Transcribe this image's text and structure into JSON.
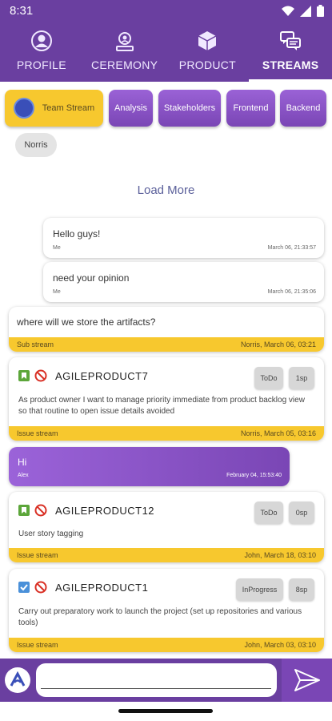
{
  "status_bar": {
    "time": "8:31"
  },
  "tabs": [
    {
      "label": "PROFILE",
      "icon": "person-icon",
      "active": false
    },
    {
      "label": "CEREMONY",
      "icon": "ceremony-icon",
      "active": false
    },
    {
      "label": "PRODUCT",
      "icon": "box-icon",
      "active": false
    },
    {
      "label": "STREAMS",
      "icon": "chat-icon",
      "active": true
    }
  ],
  "streams": {
    "team": "Team Stream",
    "items": [
      "Analysis",
      "Stakeholders",
      "Frontend",
      "Backend"
    ]
  },
  "members": [
    "Norris"
  ],
  "load_more": "Load More",
  "messages": [
    {
      "text": "Hello guys!",
      "sender": "Me",
      "time": "March 06, 21:33:57"
    },
    {
      "text": "need your opinion",
      "sender": "Me",
      "time": "March 06, 21:35:06"
    }
  ],
  "sub_stream_msg": {
    "text": "where will we store the artifacts?",
    "type": "Sub stream",
    "meta": "Norris,    March 06, 03:21"
  },
  "issues": [
    {
      "id": "AGILEPRODUCT7",
      "status": "ToDo",
      "points": "1sp",
      "description": "As product owner I want to manage priority immediate from product backlog view so that routine to open issue details avoided",
      "type": "Issue stream",
      "meta": "Norris,    March 05, 03:16",
      "icon": "bookmark-icon"
    },
    {
      "id": "AGILEPRODUCT12",
      "status": "ToDo",
      "points": "0sp",
      "description": "User story tagging",
      "type": "Issue stream",
      "meta": "John,    March 18, 03:10",
      "icon": "bookmark-icon"
    },
    {
      "id": "AGILEPRODUCT1",
      "status": "InProgress",
      "points": "8sp",
      "description": "Carry out preparatory work to launch the project (set up repositories and various tools)",
      "type": "Issue stream",
      "meta": "John,    March 03, 03:10",
      "icon": "checkbox-icon"
    }
  ],
  "incoming_msg": {
    "text": "Hi",
    "sender": "Alex",
    "time": "February 04, 15:53:40"
  },
  "composer": {
    "placeholder": ""
  },
  "colors": {
    "primary": "#6a3fa0",
    "accent": "#f7c82e",
    "bubble": "#8b55c8"
  }
}
